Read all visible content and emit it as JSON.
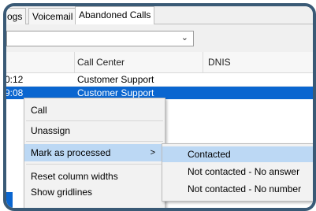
{
  "tabs": [
    "ogs",
    "Voicemail",
    "Abandoned Calls"
  ],
  "filter": {
    "chevron": "chevron-down-icon"
  },
  "grid": {
    "headers": [
      "Call Center",
      "DNIS"
    ],
    "rows": [
      {
        "time": "0:12",
        "call_center": "Customer Support",
        "dnis": "",
        "selected": false
      },
      {
        "time": "9:08",
        "call_center": "Customer Support",
        "dnis": "",
        "selected": true
      }
    ]
  },
  "context_menu": {
    "items": [
      "Call",
      "Unassign",
      "Mark as processed",
      "Reset column widths",
      "Show gridlines"
    ],
    "submenu_arrow": ">",
    "highlighted": "Mark as processed"
  },
  "submenu": {
    "items": [
      "Contacted",
      "Not contacted - No answer",
      "Not contacted - No number"
    ],
    "highlighted": "Contacted"
  },
  "colors": {
    "selection": "#0a66d0",
    "menu_highlight": "#bcd8f4",
    "frame": "#3a5a76"
  }
}
